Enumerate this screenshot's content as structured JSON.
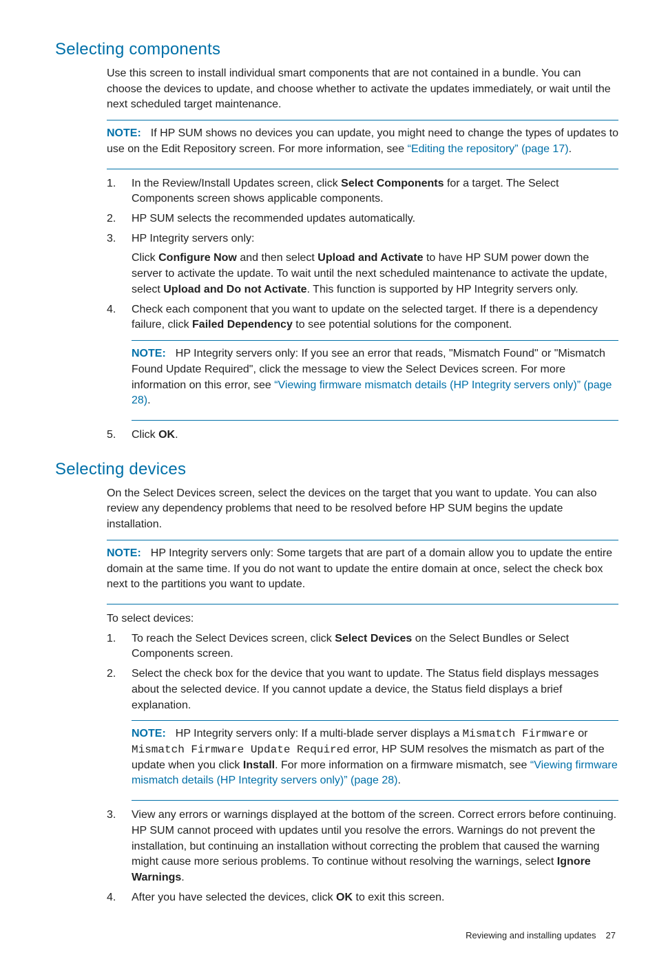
{
  "section1": {
    "title": "Selecting components",
    "intro": "Use this screen to install individual smart components that are not contained in a bundle. You can choose the devices to update, and choose whether to activate the updates immediately, or wait until the next scheduled target maintenance.",
    "note1": {
      "label": "NOTE:",
      "text_a": "If HP SUM shows no devices you can update, you might need to change the types of updates to use on the Edit Repository screen. For more information, see ",
      "link": "“Editing the repository” (page 17)",
      "tail": "."
    },
    "steps": {
      "s1_a": "In the Review/Install Updates screen, click ",
      "s1_b": "Select Components",
      "s1_c": " for a target. The Select Components screen shows applicable components.",
      "s2": "HP SUM selects the recommended updates automatically.",
      "s3_head": "HP Integrity servers only:",
      "s3_a": "Click ",
      "s3_b": "Configure Now",
      "s3_c": " and then select ",
      "s3_d": "Upload and Activate",
      "s3_e": " to have HP SUM power down the server to activate the update. To wait until the next scheduled maintenance to activate the update, select ",
      "s3_f": "Upload and Do not Activate",
      "s3_g": ". This function is supported by HP Integrity servers only.",
      "s4_a": "Check each component that you want to update on the selected target. If there is a dependency failure, click ",
      "s4_b": "Failed Dependency",
      "s4_c": " to see potential solutions for the component.",
      "s4_note_label": "NOTE:",
      "s4_note_a": "HP Integrity servers only: If you see an error that reads, \"Mismatch Found\" or \"Mismatch Found Update Required\", click the message to view the Select Devices screen. For more information on this error, see ",
      "s4_note_link": "“Viewing firmware mismatch details (HP Integrity servers only)” (page 28)",
      "s4_note_tail": ".",
      "s5_a": "Click ",
      "s5_b": "OK",
      "s5_c": "."
    }
  },
  "section2": {
    "title": "Selecting devices",
    "intro": "On the Select Devices screen, select the devices on the target that you want to update. You can also review any dependency problems that need to be resolved before HP SUM begins the update installation.",
    "note1": {
      "label": "NOTE:",
      "text": "HP Integrity servers only: Some targets that are part of a domain allow you to update the entire domain at the same time. If you do not want to update the entire domain at once, select the check box next to the partitions you want to update."
    },
    "lead": "To select devices:",
    "steps": {
      "s1_a": "To reach the Select Devices screen, click ",
      "s1_b": "Select Devices",
      "s1_c": " on the Select Bundles or Select Components screen.",
      "s2": "Select the check box for the device that you want to update. The Status field displays messages about the selected device. If you cannot update a device, the Status field displays a brief explanation.",
      "s2_note_label": "NOTE:",
      "s2_note_a": "HP Integrity servers only: If a multi-blade server displays a ",
      "s2_note_mono1": "Mismatch Firmware",
      "s2_note_b": " or ",
      "s2_note_mono2": "Mismatch Firmware Update Required",
      "s2_note_c": " error, HP SUM resolves the mismatch as part of the update when you click ",
      "s2_note_bold": "Install",
      "s2_note_d": ". For more information on a firmware mismatch, see ",
      "s2_note_link": "“Viewing firmware mismatch details (HP Integrity servers only)” (page 28)",
      "s2_note_tail": ".",
      "s3_a": "View any errors or warnings displayed at the bottom of the screen. Correct errors before continuing. HP SUM cannot proceed with updates until you resolve the errors. Warnings do not prevent the installation, but continuing an installation without correcting the problem that caused the warning might cause more serious problems. To continue without resolving the warnings, select ",
      "s3_b": "Ignore Warnings",
      "s3_c": ".",
      "s4_a": "After you have selected the devices, click ",
      "s4_b": "OK",
      "s4_c": " to exit this screen."
    }
  },
  "footer": {
    "text": "Reviewing and installing updates",
    "page": "27"
  }
}
